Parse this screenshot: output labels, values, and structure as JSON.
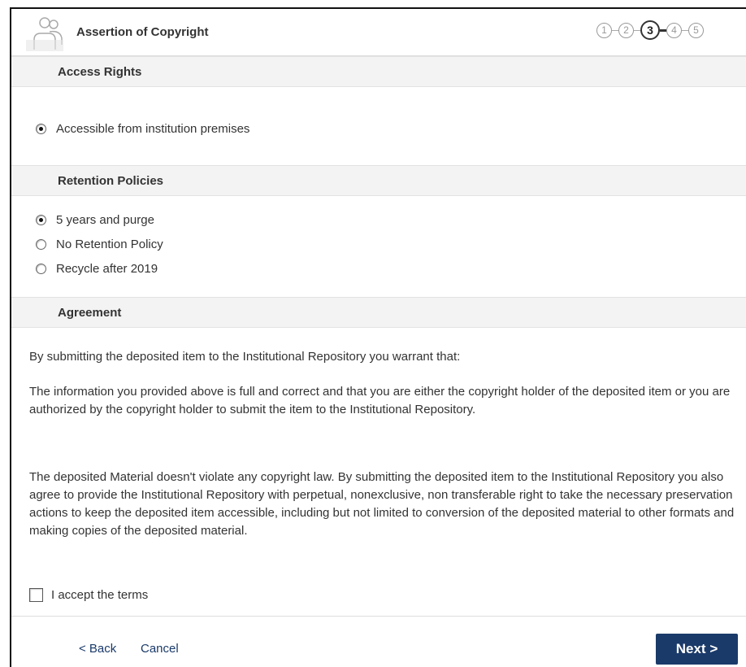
{
  "header": {
    "title": "Assertion of Copyright",
    "icon": "users-icon",
    "steps": [
      "1",
      "2",
      "3",
      "4",
      "5"
    ],
    "current_step": 3
  },
  "access_rights": {
    "heading": "Access Rights",
    "options": [
      {
        "label": "Accessible from institution premises",
        "checked": true
      }
    ]
  },
  "retention": {
    "heading": "Retention Policies",
    "options": [
      {
        "label": "5 years and purge",
        "checked": true
      },
      {
        "label": "No Retention Policy",
        "checked": false
      },
      {
        "label": "Recycle after 2019",
        "checked": false
      }
    ]
  },
  "agreement": {
    "heading": "Agreement",
    "p1": "By submitting the deposited item to the Institutional Repository you warrant that:",
    "p2": "The information you provided above is full and correct and that you are either the copyright holder of the deposited item or you are authorized by the copyright holder to submit the item to the Institutional Repository.",
    "p3": "The deposited Material doesn't violate any copyright law. By submitting the deposited item to the Institutional Repository you also agree to provide the Institutional Repository with perpetual, nonexclusive, non transferable right to take the necessary preservation actions to keep the deposited item accessible, including but not limited to conversion of the deposited material to other formats and making copies of the deposited material.",
    "accept_label": "I accept the terms",
    "accepted": false
  },
  "footer": {
    "back_label": "< Back",
    "cancel_label": "Cancel",
    "next_label": "Next >"
  },
  "colors": {
    "accent": "#1a3a6a",
    "section_bg": "#f3f3f3"
  }
}
